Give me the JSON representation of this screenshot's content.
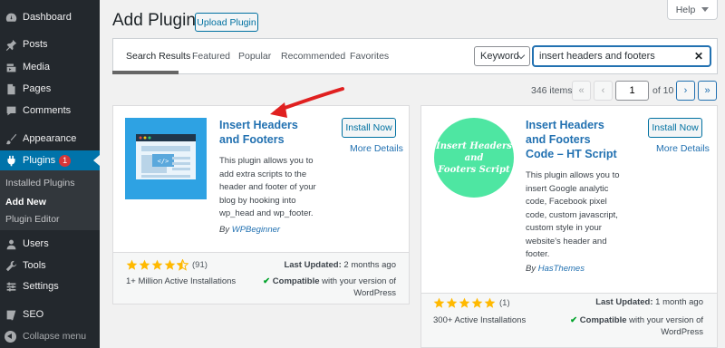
{
  "sidebar": {
    "items": [
      {
        "label": "Dashboard",
        "icon": "dashboard-icon"
      },
      {
        "label": "Posts",
        "icon": "pin-icon"
      },
      {
        "label": "Media",
        "icon": "media-icon"
      },
      {
        "label": "Pages",
        "icon": "pages-icon"
      },
      {
        "label": "Comments",
        "icon": "comments-icon"
      },
      {
        "label": "Appearance",
        "icon": "brush-icon"
      },
      {
        "label": "Plugins",
        "icon": "plugin-icon",
        "badge": "1"
      },
      {
        "label": "Users",
        "icon": "users-icon"
      },
      {
        "label": "Tools",
        "icon": "wrench-icon"
      },
      {
        "label": "Settings",
        "icon": "settings-icon"
      },
      {
        "label": "SEO",
        "icon": "seo-icon"
      }
    ],
    "submenu": [
      "Installed Plugins",
      "Add New",
      "Plugin Editor"
    ],
    "collapse_label": "Collapse menu"
  },
  "header": {
    "title": "Add Plugins",
    "upload_label": "Upload Plugin",
    "help_label": "Help"
  },
  "filter": {
    "tabs": [
      "Search Results",
      "Featured",
      "Popular",
      "Recommended",
      "Favorites"
    ],
    "keyword_label": "Keyword",
    "search_value": "insert headers and footers"
  },
  "pagination": {
    "items_count": "346 items",
    "first": "«",
    "prev": "‹",
    "current_page": "1",
    "of_pages": "of 10",
    "next": "›",
    "last": "»"
  },
  "plugins": [
    {
      "name_line1": "Insert Headers",
      "name_line2": "and Footers",
      "desc_lines": [
        "This plugin allows you to",
        "add extra scripts to the",
        "header and footer of your",
        "blog by hooking into",
        "wp_head and wp_footer."
      ],
      "by": "By",
      "author": "WPBeginner",
      "install": "Install Now",
      "more": "More Details",
      "stars": 4.5,
      "rating_count": "(91)",
      "installs": "1+ Million Active Installations",
      "updated_label": "Last Updated:",
      "updated_value": "2 months ago",
      "compat_label": "Compatible",
      "compat_rest": "with your version of",
      "compat_line2": "WordPress"
    },
    {
      "name_line1": "Insert Headers",
      "name_line2": "and Footers",
      "name_line3": "Code – HT Script",
      "logo_line1": "Insert Headers",
      "logo_line2": "and",
      "logo_line3": "Footers Script",
      "desc_lines": [
        "This plugin allows you to",
        "insert Google analytic",
        "code, Facebook pixel",
        "code, custom javascript,",
        "custom style in your",
        "website's header and",
        "footer."
      ],
      "by": "By",
      "author": "HasThemes",
      "install": "Install Now",
      "more": "More Details",
      "stars": 5,
      "rating_count": "(1)",
      "installs": "300+ Active Installations",
      "updated_label": "Last Updated:",
      "updated_value": "1 month ago",
      "compat_label": "Compatible",
      "compat_rest": "with your version of",
      "compat_line2": "WordPress"
    }
  ],
  "colors": {
    "accent": "#0073aa",
    "star": "#ffb900",
    "annotation": "#e02020"
  }
}
